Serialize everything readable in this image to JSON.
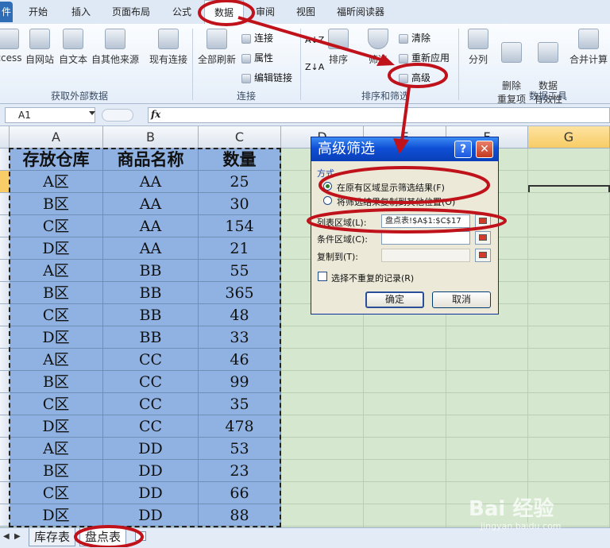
{
  "ribbon_tabs": [
    "开始",
    "插入",
    "页面布局",
    "公式",
    "数据",
    "审阅",
    "视图",
    "福昕阅读器"
  ],
  "file_tab": "件",
  "active_tab": "数据",
  "groups": {
    "external": {
      "label": "获取外部数据",
      "buttons": [
        "ccess",
        "自网站",
        "自文本",
        "自其他来源",
        "现有连接"
      ]
    },
    "connections": {
      "label": "连接",
      "refresh": "全部刷新",
      "items": [
        "连接",
        "属性",
        "编辑链接"
      ]
    },
    "sort_filter": {
      "label": "排序和筛选",
      "sort_az": "A↓Z",
      "sort_za": "Z↓A",
      "sort": "排序",
      "filter": "筛选",
      "clear": "清除",
      "reapply": "重新应用",
      "advanced": "高级"
    },
    "data_tools": {
      "label": "数据工具",
      "buttons": [
        "分列",
        "删除\n重复项",
        "数据\n有效性",
        "合并计算"
      ]
    }
  },
  "formula_bar": {
    "name_box": "A1",
    "fx": "fx"
  },
  "columns": [
    "A",
    "B",
    "C",
    "D",
    "E",
    "F",
    "G"
  ],
  "table": {
    "headers": [
      "存放仓库",
      "商品名称",
      "数量"
    ],
    "rows": [
      [
        "A区",
        "AA",
        "25"
      ],
      [
        "B区",
        "AA",
        "30"
      ],
      [
        "C区",
        "AA",
        "154"
      ],
      [
        "D区",
        "AA",
        "21"
      ],
      [
        "A区",
        "BB",
        "55"
      ],
      [
        "B区",
        "BB",
        "365"
      ],
      [
        "C区",
        "BB",
        "48"
      ],
      [
        "D区",
        "BB",
        "33"
      ],
      [
        "A区",
        "CC",
        "46"
      ],
      [
        "B区",
        "CC",
        "99"
      ],
      [
        "C区",
        "CC",
        "35"
      ],
      [
        "D区",
        "CC",
        "478"
      ],
      [
        "A区",
        "DD",
        "53"
      ],
      [
        "B区",
        "DD",
        "23"
      ],
      [
        "C区",
        "DD",
        "66"
      ],
      [
        "D区",
        "DD",
        "88"
      ]
    ]
  },
  "sheet_tabs": [
    "库存表",
    "盘点表"
  ],
  "dialog": {
    "title": "高级筛选",
    "help": "?",
    "close": "✕",
    "method_label": "方式",
    "option1": "在原有区域显示筛选结果(F)",
    "option2": "将筛选结果复制到其他位置(O)",
    "list_range_label": "列表区域(L):",
    "list_range_value": "盘点表!$A$1:$C$17",
    "criteria_label": "条件区域(C):",
    "criteria_value": "",
    "copy_to_label": "复制到(T):",
    "copy_to_value": "",
    "unique_label": "选择不重复的记录(R)",
    "ok": "确定",
    "cancel": "取消"
  },
  "watermark": {
    "brand": "Bai 经验",
    "url": "jingyan.baidu.com"
  },
  "colors": {
    "table_fill": "#8fb2e2",
    "grid_bg": "#d5e8cf",
    "annotation": "#c0121b",
    "dialog_title": "#0f4fd6"
  }
}
